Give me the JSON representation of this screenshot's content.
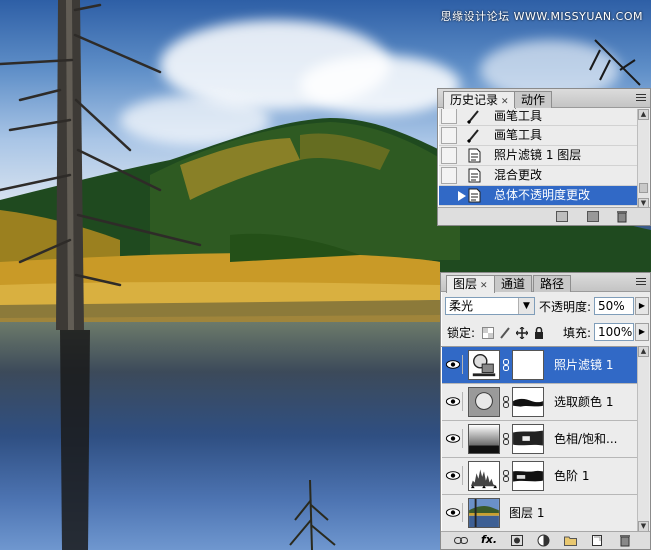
{
  "watermark": "思缘设计论坛 WWW.MISSYUAN.COM",
  "history_panel": {
    "tabs": [
      {
        "label": "历史记录",
        "active": true,
        "closable": true
      },
      {
        "label": "动作",
        "active": false,
        "closable": false
      }
    ],
    "items": [
      {
        "label": "画笔工具",
        "icon": "brush-icon",
        "selected": false
      },
      {
        "label": "画笔工具",
        "icon": "brush-icon",
        "selected": false
      },
      {
        "label": "照片滤镜 1 图层",
        "icon": "document-icon",
        "selected": false
      },
      {
        "label": "混合更改",
        "icon": "document-icon",
        "selected": false
      },
      {
        "label": "总体不透明度更改",
        "icon": "document-icon",
        "selected": true
      }
    ],
    "footer_icons": [
      "new-document-from-state-icon",
      "new-snapshot-icon",
      "delete-state-icon"
    ]
  },
  "layers_panel": {
    "tabs": [
      {
        "label": "图层",
        "active": true,
        "closable": true
      },
      {
        "label": "通道",
        "active": false,
        "closable": false
      },
      {
        "label": "路径",
        "active": false,
        "closable": false
      }
    ],
    "blend_mode": "柔光",
    "opacity_label": "不透明度:",
    "opacity_value": "50%",
    "lock_label": "锁定:",
    "fill_label": "填充:",
    "fill_value": "100%",
    "layers": [
      {
        "name": "照片滤镜 1",
        "type": "photo-filter",
        "selected": true,
        "visible": true
      },
      {
        "name": "选取颜色 1",
        "type": "selective-color",
        "selected": false,
        "visible": true
      },
      {
        "name": "色相/饱和...",
        "type": "hue-saturation",
        "selected": false,
        "visible": true
      },
      {
        "name": "色阶 1",
        "type": "levels",
        "selected": false,
        "visible": true
      },
      {
        "name": "图层 1",
        "type": "image",
        "selected": false,
        "visible": true
      }
    ],
    "footer_icons": [
      "link-layers-icon",
      "fx-icon",
      "layer-mask-icon",
      "adjustment-layer-icon",
      "group-folder-icon",
      "new-layer-icon",
      "trash-icon"
    ],
    "fx_label": "fx."
  },
  "colors": {
    "selection": "#3169c6",
    "panel_bg": "#ececec"
  }
}
